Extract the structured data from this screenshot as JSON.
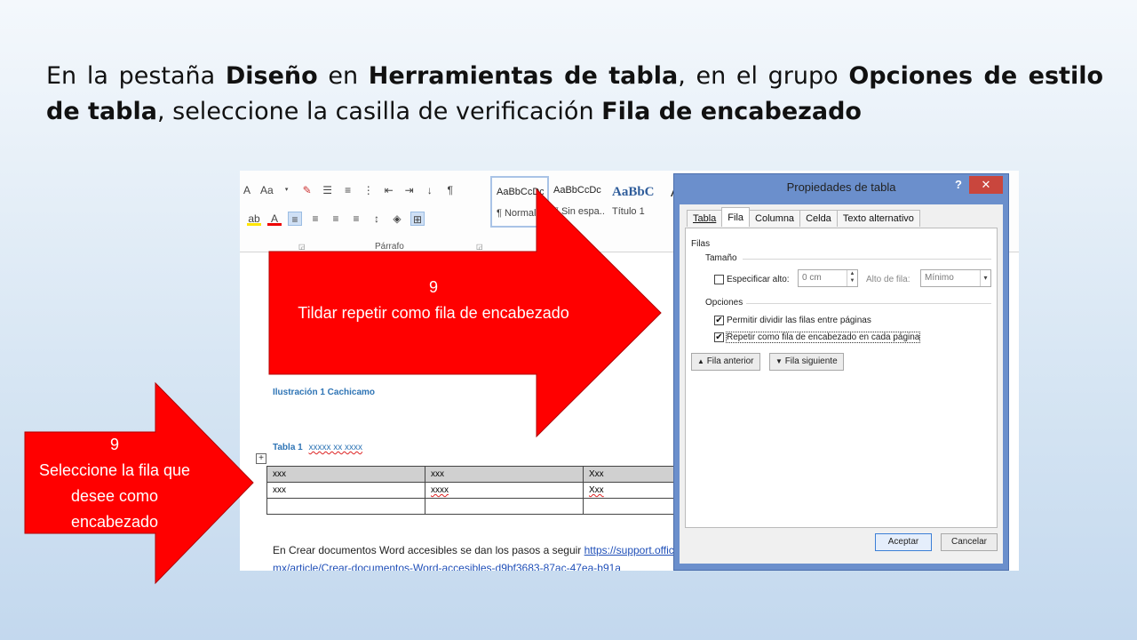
{
  "slide": {
    "instruction": [
      {
        "text": "En la pestaña ",
        "bold": false
      },
      {
        "text": "Diseño",
        "bold": true
      },
      {
        "text": " en ",
        "bold": false
      },
      {
        "text": "Herramientas de tabla",
        "bold": true
      },
      {
        "text": ", en el grupo ",
        "bold": false
      },
      {
        "text": "Opciones de estilo de tabla",
        "bold": true
      },
      {
        "text": ", seleccione la casilla de verificación ",
        "bold": false
      },
      {
        "text": "Fila de encabezado",
        "bold": true
      }
    ]
  },
  "ribbon": {
    "font_size_label": "Aa",
    "group_parrafo": "Párrafo",
    "styles": [
      {
        "preview": "AaBbCcDc",
        "name": "¶ Normal"
      },
      {
        "preview": "AaBbCcDc",
        "name": "¶ Sin espa..."
      },
      {
        "preview": "AaBbC",
        "name": "Título 1"
      },
      {
        "preview": "A",
        "name": ""
      }
    ]
  },
  "document": {
    "caption_figure": "Ilustración 1 Cachicamo",
    "caption_table": "Tabla 1",
    "caption_table_suffix": "xxxxx xx  xxxx",
    "table": [
      [
        "xxx",
        "xxx",
        "Xxx"
      ],
      [
        "xxx",
        "xxxx",
        "Xxx"
      ],
      [
        "",
        "",
        ""
      ]
    ],
    "footer_text": "En  Crear documentos Word accesibles se dan los pasos a seguir  ",
    "footer_link": "https://support.offic",
    "footer_link2": "mx/article/Crear-documentos-Word-accesibles-d9bf3683-87ac-47ea-b91a"
  },
  "dialog": {
    "title": "Propiedades de tabla",
    "help": "?",
    "close": "✕",
    "tabs": [
      "Tabla",
      "Fila",
      "Columna",
      "Celda",
      "Texto alternativo"
    ],
    "active_tab": "Fila",
    "section_filas": "Filas",
    "section_tamano": "Tamaño",
    "specify_height_label": "Especificar alto:",
    "specify_height_checked": false,
    "height_value": "0 cm",
    "row_height_label": "Alto de fila:",
    "row_height_value": "Mínimo",
    "section_opciones": "Opciones",
    "allow_split_label": "Permitir dividir las filas entre páginas",
    "allow_split_checked": true,
    "repeat_header_label": "Repetir como fila de encabezado en cada página",
    "repeat_header_checked": true,
    "prev_row_button": "Fila anterior",
    "next_row_button": "Fila siguiente",
    "ok_button": "Aceptar",
    "cancel_button": "Cancelar"
  },
  "arrows": {
    "top": {
      "step": "9",
      "text": "Tildar repetir como fila de encabezado"
    },
    "left": {
      "step": "9",
      "text": "Seleccione la fila que desee como encabezado"
    },
    "color": "#ff0000"
  }
}
